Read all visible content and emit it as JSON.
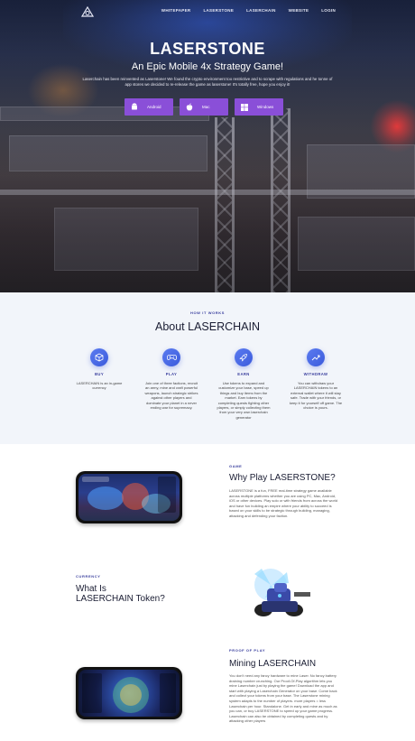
{
  "nav": {
    "links": [
      "Whitepaper",
      "LaserStone",
      "LaserChain",
      "Website",
      "Login"
    ]
  },
  "hero": {
    "title": "LASERSTONE",
    "subtitle": "An Epic Mobile 4x Strategy Game!",
    "description": "Laserchain has been reinvented as Laserstone! We found the crypto environment too restrictive and to scrape with regulations and he tonne of app stores we decided to re-release the game as laserstone! It's totally free, hope you enjoy it!",
    "buttons": [
      {
        "label": "Android",
        "icon": "android-icon"
      },
      {
        "label": "Mac",
        "icon": "apple-icon"
      },
      {
        "label": "Windows",
        "icon": "windows-icon"
      }
    ]
  },
  "about": {
    "eyebrow": "How it works",
    "title": "About LASERCHAIN",
    "features": [
      {
        "title": "BUY",
        "icon": "cube-icon",
        "text": "LASERCHAIN is an in-game currency"
      },
      {
        "title": "PLAY",
        "icon": "gamepad-icon",
        "text": "Join one of three factions, recruit an army, mine and craft powerful weapons, launch strategic strikes against other players and dominate your planet in a never ending war for supremacy."
      },
      {
        "title": "EARN",
        "icon": "rocket-icon",
        "text": "Use tokens to expand and customize your base, speed up things and buy items from the market. Earn tokens by completing quests fighting other players, or simply collecting them from your very own laserchain generator"
      },
      {
        "title": "WITHDRAW",
        "icon": "chart-icon",
        "text": "You can withdraw your LASERCHAIN tokens to an external wallet where it will stay safe. Trade with your friends, or keep it for yourself off game. The choice is yours."
      }
    ]
  },
  "why": {
    "eyebrow": "Game",
    "title": "Why Play LASERSTONE?",
    "text": "LASERSTONE is a fun, FREE real-time strategy game available across multiple platforms whether you are using PC, Mac, Android, iOS or other devices. Play solo or with friends from across the world and have fun building an empire where your ability to succeed is based on your skills to be strategic through building, managing, attacking and defending your faction."
  },
  "currency": {
    "eyebrow": "Currency",
    "title": "What Is LASERCHAIN Token?"
  },
  "mining": {
    "eyebrow": "Proof of play",
    "title": "Mining LASERCHAIN",
    "text": "You don't need any fancy hardware to mine Laser. No fancy battery draining number crunching. Our Proof-Of-Play algorithm lets you mine Laserchain just by playing the game! Download the app and start with playing a Laserchain Generator on your base. Come back and collect your tokens from your base. The Laserstone mining system adapts to the number of players. more players = less Laserchain per hour. Standalone. Get in early and mine as much as you can, or buy LASERSTONE to speed up your game progress. Laserchain can also be obtained by completing quests and by attacking other players"
  },
  "colors": {
    "accent": "#8a4fd8",
    "brand_blue": "#3a3f9e",
    "icon_blue": "#4a6ce6"
  }
}
